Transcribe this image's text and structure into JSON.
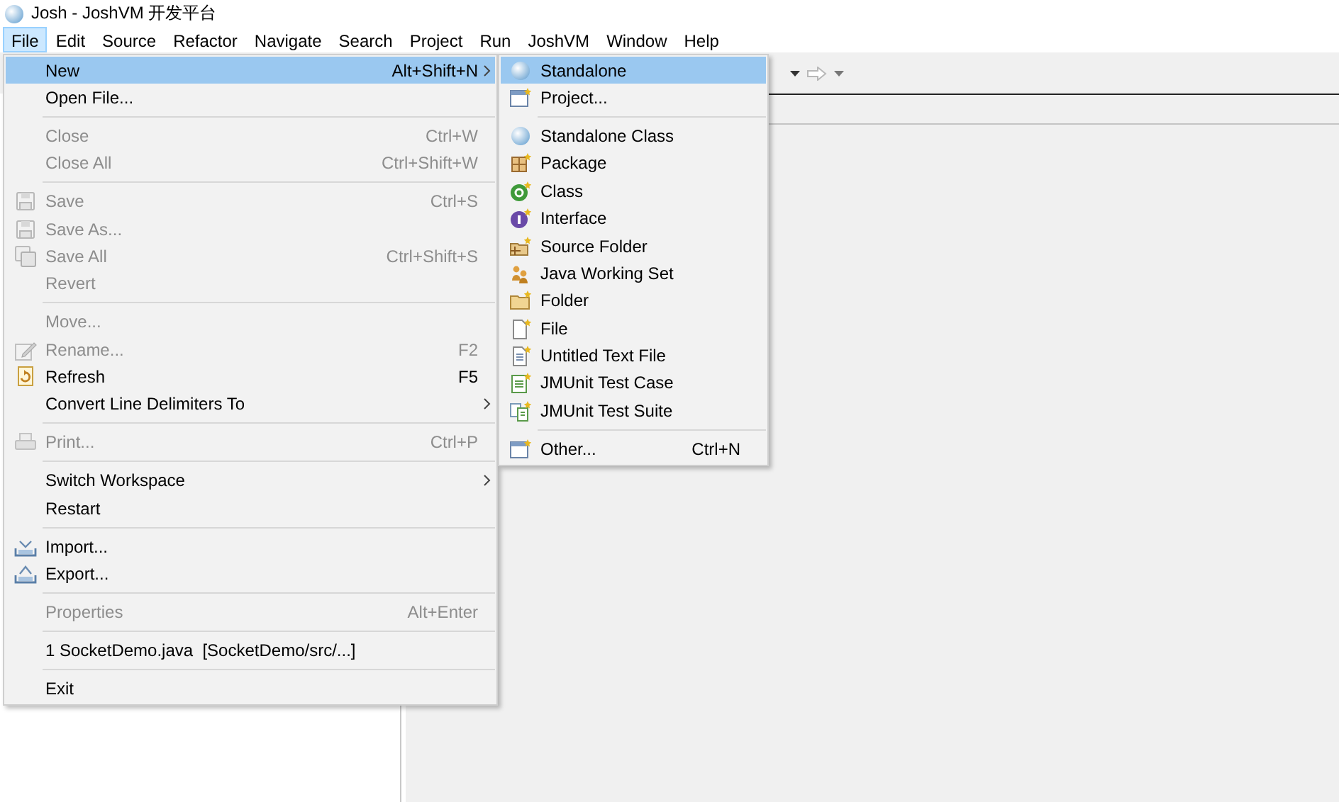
{
  "window": {
    "title": "Josh - JoshVM 开发平台"
  },
  "menu_bar": [
    {
      "label": "File",
      "selected": true
    },
    {
      "label": "Edit",
      "selected": false
    },
    {
      "label": "Source",
      "selected": false
    },
    {
      "label": "Refactor",
      "selected": false
    },
    {
      "label": "Navigate",
      "selected": false
    },
    {
      "label": "Search",
      "selected": false
    },
    {
      "label": "Project",
      "selected": false
    },
    {
      "label": "Run",
      "selected": false
    },
    {
      "label": "JoshVM",
      "selected": false
    },
    {
      "label": "Window",
      "selected": false
    },
    {
      "label": "Help",
      "selected": false
    }
  ],
  "file_menu": {
    "items": [
      {
        "kind": "item",
        "label": "New",
        "shortcut": "Alt+Shift+N",
        "submenu": true,
        "disabled": false,
        "selected": true
      },
      {
        "kind": "item",
        "label": "Open File...",
        "disabled": false,
        "selected": false
      },
      {
        "kind": "separator"
      },
      {
        "kind": "item",
        "label": "Close",
        "shortcut": "Ctrl+W",
        "disabled": true,
        "selected": false
      },
      {
        "kind": "item",
        "label": "Close All",
        "shortcut": "Ctrl+Shift+W",
        "disabled": true,
        "selected": false
      },
      {
        "kind": "separator"
      },
      {
        "kind": "item",
        "label": "Save",
        "shortcut": "Ctrl+S",
        "disabled": true,
        "selected": false
      },
      {
        "kind": "item",
        "label": "Save As...",
        "disabled": true,
        "selected": false
      },
      {
        "kind": "item",
        "label": "Save All",
        "shortcut": "Ctrl+Shift+S",
        "disabled": true,
        "selected": false
      },
      {
        "kind": "item",
        "label": "Revert",
        "disabled": true,
        "selected": false
      },
      {
        "kind": "separator"
      },
      {
        "kind": "item",
        "label": "Move...",
        "disabled": true,
        "selected": false
      },
      {
        "kind": "item",
        "label": "Rename...",
        "shortcut": "F2",
        "disabled": true,
        "selected": false
      },
      {
        "kind": "item",
        "label": "Refresh",
        "shortcut": "F5",
        "disabled": false,
        "selected": false
      },
      {
        "kind": "item",
        "label": "Convert Line Delimiters To",
        "submenu": true,
        "disabled": false,
        "selected": false
      },
      {
        "kind": "separator"
      },
      {
        "kind": "item",
        "label": "Print...",
        "shortcut": "Ctrl+P",
        "disabled": true,
        "selected": false
      },
      {
        "kind": "separator"
      },
      {
        "kind": "item",
        "label": "Switch Workspace",
        "submenu": true,
        "disabled": false,
        "selected": false
      },
      {
        "kind": "item",
        "label": "Restart",
        "disabled": false,
        "selected": false
      },
      {
        "kind": "separator"
      },
      {
        "kind": "item",
        "label": "Import...",
        "disabled": false,
        "selected": false
      },
      {
        "kind": "item",
        "label": "Export...",
        "disabled": false,
        "selected": false
      },
      {
        "kind": "separator"
      },
      {
        "kind": "item",
        "label": "Properties",
        "shortcut": "Alt+Enter",
        "disabled": true,
        "selected": false
      },
      {
        "kind": "separator"
      },
      {
        "kind": "item",
        "label": "1 SocketDemo.java  [SocketDemo/src/...]",
        "disabled": false,
        "selected": false
      },
      {
        "kind": "separator"
      },
      {
        "kind": "item",
        "label": "Exit",
        "disabled": false,
        "selected": false
      }
    ]
  },
  "new_submenu": {
    "items": [
      {
        "kind": "item",
        "label": "Standalone",
        "selected": true
      },
      {
        "kind": "item",
        "label": "Project...",
        "selected": false
      },
      {
        "kind": "separator"
      },
      {
        "kind": "item",
        "label": "Standalone Class",
        "selected": false
      },
      {
        "kind": "item",
        "label": "Package",
        "selected": false
      },
      {
        "kind": "item",
        "label": "Class",
        "selected": false
      },
      {
        "kind": "item",
        "label": "Interface",
        "selected": false
      },
      {
        "kind": "item",
        "label": "Source Folder",
        "selected": false
      },
      {
        "kind": "item",
        "label": "Java Working Set",
        "selected": false
      },
      {
        "kind": "item",
        "label": "Folder",
        "selected": false
      },
      {
        "kind": "item",
        "label": "File",
        "selected": false
      },
      {
        "kind": "item",
        "label": "Untitled Text File",
        "selected": false
      },
      {
        "kind": "item",
        "label": "JMUnit Test Case",
        "selected": false
      },
      {
        "kind": "item",
        "label": "JMUnit Test Suite",
        "selected": false
      },
      {
        "kind": "separator"
      },
      {
        "kind": "item",
        "label": "Other...",
        "shortcut": "Ctrl+N",
        "selected": false
      }
    ]
  }
}
